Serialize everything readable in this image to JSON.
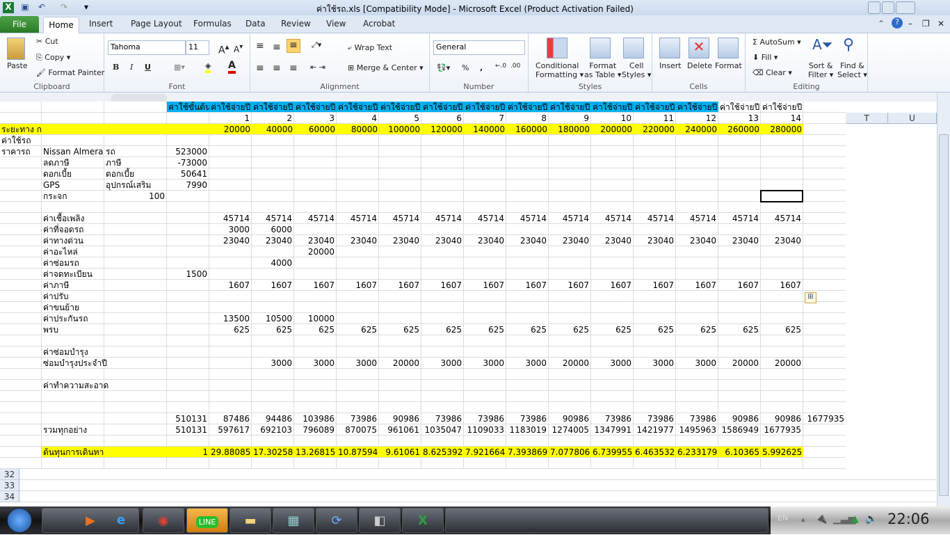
{
  "window": {
    "title": "ค่าใช้รถ.xls  [Compatibility Mode]  -  Microsoft Excel (Product Activation Failed)"
  },
  "tabs": [
    "File",
    "Home",
    "Insert",
    "Page Layout",
    "Formulas",
    "Data",
    "Review",
    "View",
    "Acrobat"
  ],
  "ribbon": {
    "clipboard": {
      "label": "Clipboard",
      "paste": "Paste",
      "cut": "Cut",
      "copy": "Copy",
      "format_painter": "Format Painter"
    },
    "font": {
      "label": "Font",
      "name": "Tahoma",
      "size": "11",
      "bold": "B",
      "italic": "I",
      "underline": "U"
    },
    "alignment": {
      "label": "Alignment",
      "wrap": "Wrap Text",
      "merge": "Merge & Center"
    },
    "number": {
      "label": "Number",
      "format": "General",
      "percent": "%",
      "comma": ","
    },
    "styles": {
      "label": "Styles",
      "conditional": "Conditional",
      "conditional2": "Formatting",
      "format_table": "Format",
      "format_table2": "as Table",
      "cell_styles": "Cell",
      "cell_styles2": "Styles"
    },
    "cells": {
      "label": "Cells",
      "insert": "Insert",
      "delete": "Delete",
      "format": "Format"
    },
    "editing": {
      "label": "Editing",
      "autosum": "AutoSum",
      "fill": "Fill",
      "clear": "Clear",
      "sort": "Sort &",
      "sort2": "Filter",
      "find": "Find &",
      "find2": "Select"
    }
  },
  "colors": {
    "header_cyan": "#00b0f0",
    "highlight_yellow": "#ffff00"
  },
  "column_headers": [
    "T",
    "U"
  ],
  "row_numbers": [
    "32",
    "33",
    "34"
  ],
  "rows": [
    {
      "cells": {
        "D": "ค่าใช้ขั้นต้น",
        "E": "ค่าใช้จ่ายปี",
        "F": "ค่าใช้จ่ายปี",
        "G": "ค่าใช้จ่ายปี",
        "H": "ค่าใช้จ่ายปี",
        "I": "ค่าใช้จ่ายปี",
        "J": "ค่าใช้จ่ายปี",
        "K": "ค่าใช้จ่ายปี",
        "L": "ค่าใช้จ่ายปี",
        "M": "ค่าใช้จ่ายปี",
        "N": "ค่าใช้จ่ายปี",
        "O": "ค่าใช้จ่ายปี",
        "P": "ค่าใช้จ่ายปี",
        "Q": "ค่าใช้จ่ายปี",
        "R": "ค่าใช้จ่ายปี"
      },
      "fill": "cyan",
      "fill_to": "P"
    },
    {
      "cells": {
        "E": "1",
        "F": "2",
        "G": "3",
        "H": "4",
        "I": "5",
        "J": "6",
        "K": "7",
        "L": "8",
        "M": "9",
        "N": "10",
        "O": "11",
        "P": "12",
        "Q": "13",
        "R": "14"
      }
    },
    {
      "cells": {
        "A": "ระยะทาง กม",
        "E": "20000",
        "F": "40000",
        "G": "60000",
        "H": "80000",
        "I": "100000",
        "J": "120000",
        "K": "140000",
        "L": "160000",
        "M": "180000",
        "N": "200000",
        "O": "220000",
        "P": "240000",
        "Q": "260000",
        "R": "280000"
      },
      "fill": "yellow",
      "fill_to": "R"
    },
    {
      "cells": {
        "A": "ค่าใช้รถ"
      }
    },
    {
      "cells": {
        "A": "ราคารถ",
        "B": "Nissan Almera",
        "C": "รถ",
        "D": "523000"
      }
    },
    {
      "cells": {
        "B": "ลดภาษี",
        "C": "ภาษี",
        "D": "-73000"
      }
    },
    {
      "cells": {
        "B": "ดอกเบี้ย",
        "C": "ดอกเบี้ย",
        "D": "50641"
      }
    },
    {
      "cells": {
        "B": "GPS",
        "C": "อุปกรณ์เสริม",
        "D": "7990"
      }
    },
    {
      "cells": {
        "B": "กระจก",
        "C": "100"
      }
    },
    {
      "cells": {}
    },
    {
      "cells": {
        "B": "ค่าเชื้อเพลิง",
        "E": "45714",
        "F": "45714",
        "G": "45714",
        "H": "45714",
        "I": "45714",
        "J": "45714",
        "K": "45714",
        "L": "45714",
        "M": "45714",
        "N": "45714",
        "O": "45714",
        "P": "45714",
        "Q": "45714",
        "R": "45714"
      }
    },
    {
      "cells": {
        "B": "ค่าที่จอดรถ",
        "E": "3000",
        "F": "6000"
      }
    },
    {
      "cells": {
        "B": "ค่าทางด่วน",
        "E": "23040",
        "F": "23040",
        "G": "23040",
        "H": "23040",
        "I": "23040",
        "J": "23040",
        "K": "23040",
        "L": "23040",
        "M": "23040",
        "N": "23040",
        "O": "23040",
        "P": "23040",
        "Q": "23040",
        "R": "23040"
      }
    },
    {
      "cells": {
        "B": "ค่าอะไหล่",
        "G": "20000"
      }
    },
    {
      "cells": {
        "B": "ค่าซ่อมรถ",
        "F": "4000"
      }
    },
    {
      "cells": {
        "B": "ค่าจดทะเบียน",
        "D": "1500"
      }
    },
    {
      "cells": {
        "B": "ค่าภาษี",
        "E": "1607",
        "F": "1607",
        "G": "1607",
        "H": "1607",
        "I": "1607",
        "J": "1607",
        "K": "1607",
        "L": "1607",
        "M": "1607",
        "N": "1607",
        "O": "1607",
        "P": "1607",
        "Q": "1607",
        "R": "1607"
      }
    },
    {
      "cells": {
        "B": "ค่าปรับ"
      }
    },
    {
      "cells": {
        "B": "ค่าขนย้าย"
      }
    },
    {
      "cells": {
        "B": "ค่าประกันรถ",
        "E": "13500",
        "F": "10500",
        "G": "10000"
      }
    },
    {
      "cells": {
        "B": "พรบ",
        "E": "625",
        "F": "625",
        "G": "625",
        "H": "625",
        "I": "625",
        "J": "625",
        "K": "625",
        "L": "625",
        "M": "625",
        "N": "625",
        "O": "625",
        "P": "625",
        "Q": "625",
        "R": "625"
      }
    },
    {
      "cells": {}
    },
    {
      "cells": {
        "B": "ค่าซ่อมบำรุง"
      }
    },
    {
      "cells": {
        "B": "ซ่อมบำรุงประจำปี",
        "F": "3000",
        "G": "3000",
        "H": "3000",
        "I": "20000",
        "J": "3000",
        "K": "3000",
        "L": "3000",
        "M": "20000",
        "N": "3000",
        "O": "3000",
        "P": "3000",
        "Q": "20000",
        "R": "20000"
      }
    },
    {
      "cells": {}
    },
    {
      "cells": {
        "B": "ค่าทำความสะอาด"
      }
    },
    {
      "cells": {}
    },
    {
      "cells": {}
    },
    {
      "cells": {
        "D": "510131",
        "E": "87486",
        "F": "94486",
        "G": "103986",
        "H": "73986",
        "I": "90986",
        "J": "73986",
        "K": "73986",
        "L": "73986",
        "M": "90986",
        "N": "73986",
        "O": "73986",
        "P": "73986",
        "Q": "90986",
        "R": "90986",
        "S": "1677935"
      }
    },
    {
      "cells": {
        "B": "รวมทุกอย่าง",
        "D": "510131",
        "E": "597617",
        "F": "692103",
        "G": "796089",
        "H": "870075",
        "I": "961061",
        "J": "1035047",
        "K": "1109033",
        "L": "1183019",
        "M": "1274005",
        "N": "1347991",
        "O": "1421977",
        "P": "1495963",
        "Q": "1586949",
        "R": "1677935"
      }
    },
    {
      "cells": {}
    },
    {
      "cells": {
        "B": "ต้นทุนการเดินทาง กม/บาท",
        "D": "1",
        "E": "29.88085",
        "F": "17.30258",
        "G": "13.26815",
        "H": "10.87594",
        "I": "9.61061",
        "J": "8.625392",
        "K": "7.921664",
        "L": "7.393869",
        "M": "7.077806",
        "N": "6.739955",
        "O": "6.463532",
        "P": "6.233179",
        "Q": "6.10365",
        "R": "5.992625"
      },
      "fill": "yellow",
      "fill_from": "B",
      "fill_to": "R"
    },
    {
      "cells": {}
    }
  ],
  "taskbar": {
    "apps": [
      "media-player",
      "internet-explorer",
      "chrome",
      "LINE",
      "explorer",
      "calculator",
      "sync",
      "drive-app",
      "excel"
    ],
    "lang": "EN",
    "clock": "22:06"
  }
}
